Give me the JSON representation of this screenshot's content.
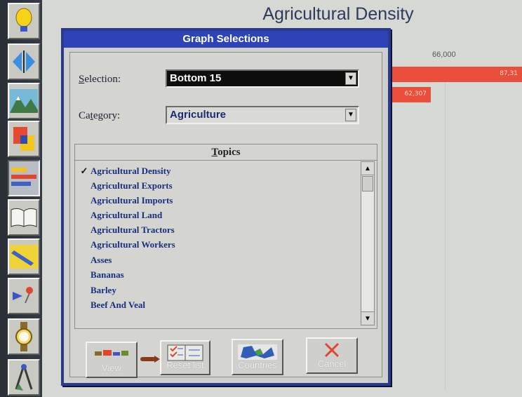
{
  "window": {
    "title": "Agricultural Density",
    "axis_tick": "66,000",
    "bars": [
      {
        "label": "87,31",
        "value_fraction": 1.0
      },
      {
        "label": "62,307",
        "value_fraction": 0.12
      }
    ]
  },
  "toolbar": {
    "items": [
      {
        "name": "idea-icon"
      },
      {
        "name": "navigate-icon"
      },
      {
        "name": "landscape-icon"
      },
      {
        "name": "shapes-icon"
      },
      {
        "name": "bar-chart-icon"
      },
      {
        "name": "book-icon"
      },
      {
        "name": "pencil-icon"
      },
      {
        "name": "pushpin-icon"
      },
      {
        "name": "watch-icon"
      },
      {
        "name": "compass-icon"
      }
    ]
  },
  "dialog": {
    "title": "Graph Selections",
    "selection_label": "Selection:",
    "selection_value": "Bottom 15",
    "category_label": "Category:",
    "category_value": "Agriculture",
    "topics_header": "Topics",
    "topics": [
      {
        "label": "Agricultural Density",
        "checked": true
      },
      {
        "label": "Agricultural Exports",
        "checked": false
      },
      {
        "label": "Agricultural Imports",
        "checked": false
      },
      {
        "label": "Agricultural Land",
        "checked": false
      },
      {
        "label": "Agricultural Tractors",
        "checked": false
      },
      {
        "label": "Agricultural Workers",
        "checked": false
      },
      {
        "label": "Asses",
        "checked": false
      },
      {
        "label": "Bananas",
        "checked": false
      },
      {
        "label": "Barley",
        "checked": false
      },
      {
        "label": "Beef And Veal",
        "checked": false
      }
    ],
    "buttons": {
      "view": "View",
      "reset": "Reset list",
      "countries": "Countries",
      "cancel": "Cancel"
    }
  },
  "colors": {
    "titlebar": "#2e44b6",
    "bar": "#ea4f3b",
    "dialog_border": "#2b3a8c"
  }
}
